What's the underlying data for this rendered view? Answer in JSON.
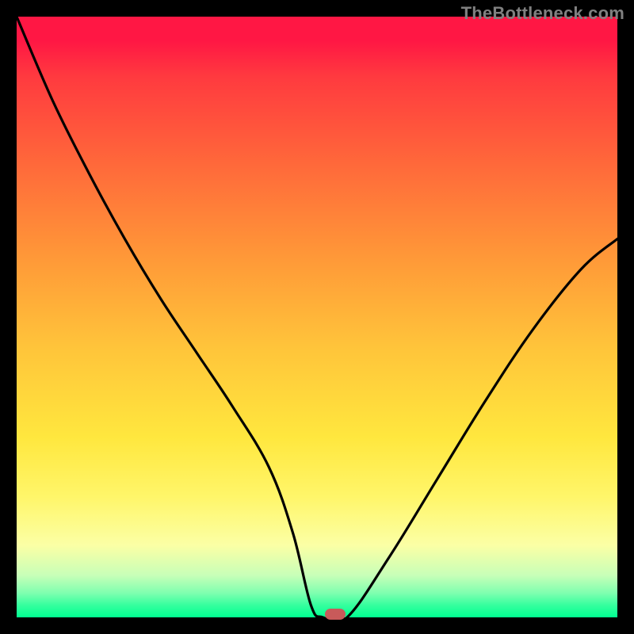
{
  "watermark": "TheBottleneck.com",
  "chart_data": {
    "type": "line",
    "title": "",
    "xlabel": "",
    "ylabel": "",
    "xlim": [
      0,
      100
    ],
    "ylim": [
      0,
      100
    ],
    "series": [
      {
        "name": "curve",
        "x": [
          0,
          6,
          12,
          18,
          24,
          30,
          36,
          42,
          46,
          49,
          51,
          55,
          62,
          70,
          78,
          86,
          94,
          100
        ],
        "y": [
          100,
          86,
          74,
          63,
          53,
          44,
          35,
          25,
          14,
          2,
          0,
          0,
          10,
          23,
          36,
          48,
          58,
          63
        ]
      }
    ],
    "marker": {
      "x": 53,
      "y": 0,
      "color": "#c85a5a"
    },
    "gradient_colors": {
      "top": "#ff1744",
      "mid_upper": "#ff9838",
      "mid_lower": "#ffe73e",
      "bottom": "#00ff91"
    },
    "grid": false,
    "legend": false
  }
}
